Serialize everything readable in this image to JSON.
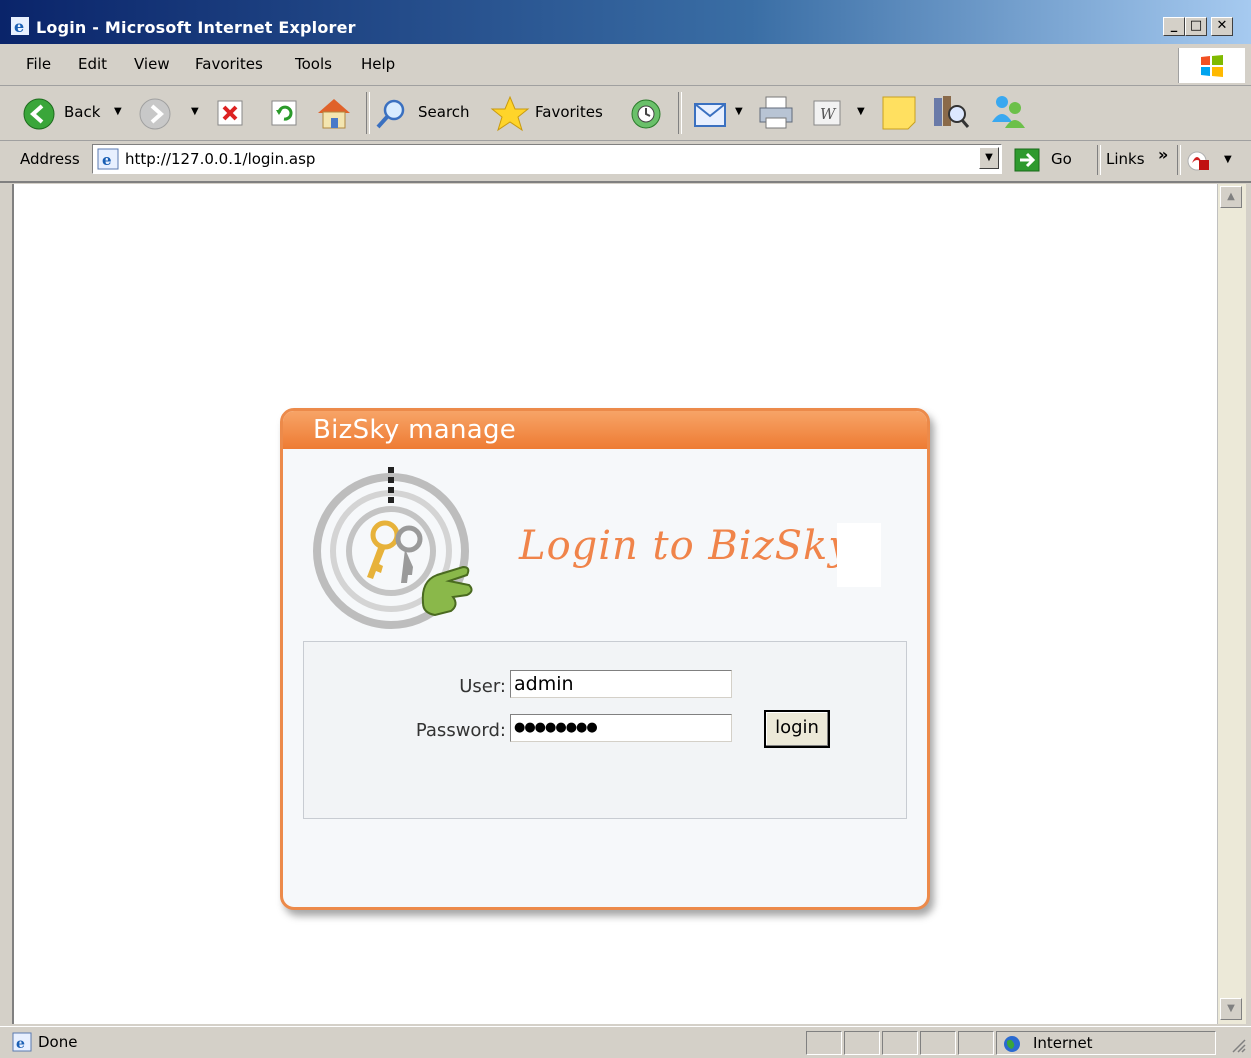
{
  "window": {
    "title": "Login - Microsoft Internet Explorer",
    "controls": {
      "minimize": "_",
      "maximize": "□",
      "close": "✕"
    }
  },
  "menu": {
    "items": [
      {
        "label": "File"
      },
      {
        "label": "Edit"
      },
      {
        "label": "View"
      },
      {
        "label": "Favorites"
      },
      {
        "label": "Tools"
      },
      {
        "label": "Help"
      }
    ]
  },
  "toolbar": {
    "back_label": "Back",
    "search_label": "Search",
    "favorites_label": "Favorites"
  },
  "address": {
    "label": "Address",
    "url": "http://127.0.0.1/login.asp",
    "go_label": "Go",
    "links_label": "Links",
    "chevron": "»"
  },
  "page": {
    "panel_title": "BizSky manage",
    "heading": "Login to BizSky",
    "user_label": "User:",
    "user_value": "admin",
    "password_label": "Password:",
    "password_mask": "●●●●●●●●",
    "login_button": "login"
  },
  "status": {
    "text": "Done",
    "zone": "Internet"
  },
  "colors": {
    "titlebar": "#0a246a",
    "panel_accent": "#ee7b33",
    "heading": "#f0844a"
  }
}
